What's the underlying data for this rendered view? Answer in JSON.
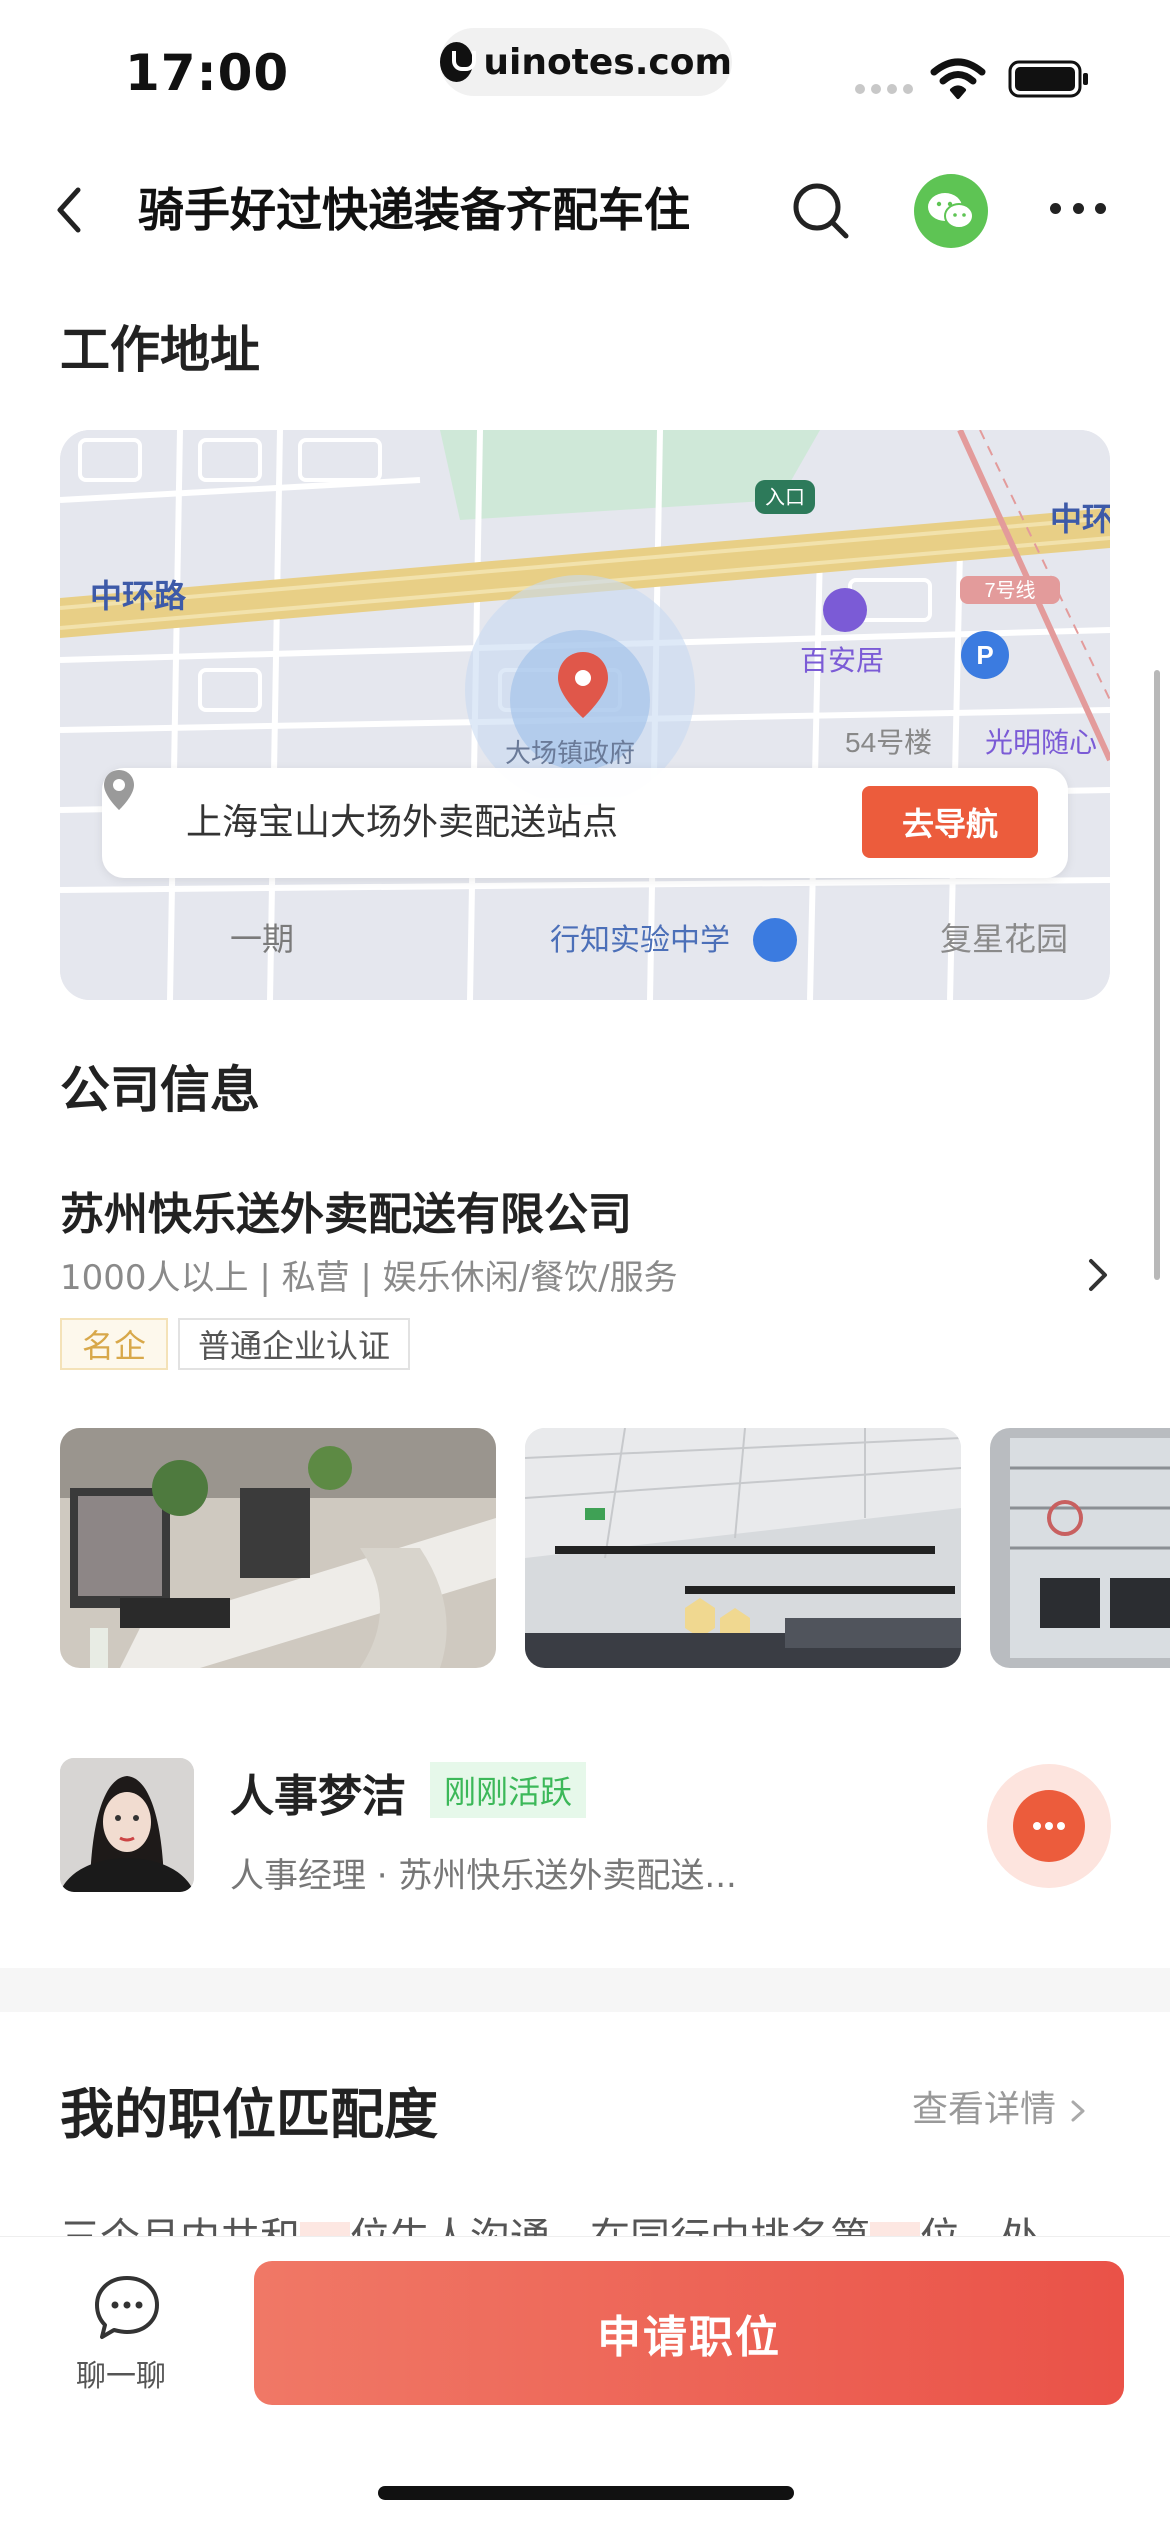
{
  "status_bar": {
    "time": "17:00",
    "url": "uinotes.com"
  },
  "nav": {
    "title": "骑手好过快递装备齐配车住"
  },
  "work_address": {
    "section_title": "工作地址",
    "address": "上海宝山大场外卖配送站点",
    "navigate_label": "去导航",
    "map_labels": {
      "road_left": "中环路",
      "road_right": "中环",
      "entrance": "入口",
      "line7": "7号线",
      "baianju": "百安居",
      "building54": "54号楼",
      "guangming": "光明随心",
      "govt": "大场镇政府",
      "phase1": "一期",
      "school": "行知实验中学",
      "fuxing": "复星花园"
    }
  },
  "company": {
    "section_title": "公司信息",
    "name": "苏州快乐送外卖配送有限公司",
    "meta": "1000人以上 | 私营 | 娱乐休闲/餐饮/服务",
    "tag_famous": "名企",
    "tag_cert": "普通企业认证"
  },
  "hr": {
    "name": "人事梦洁",
    "active": "刚刚活跃",
    "title": "人事经理 · 苏州快乐送外卖配送..."
  },
  "match": {
    "title": "我的职位匹配度",
    "details_link": "查看详情",
    "text_a": "三个月内共和",
    "text_b": "位牛人沟通，在同行中排名第",
    "text_c": "位，处"
  },
  "bottom": {
    "chat_label": "聊一聊",
    "apply_label": "申请职位"
  },
  "colors": {
    "accent": "#ec5c3c",
    "active_green": "#3cb859",
    "wechat_green": "#5ec454"
  }
}
